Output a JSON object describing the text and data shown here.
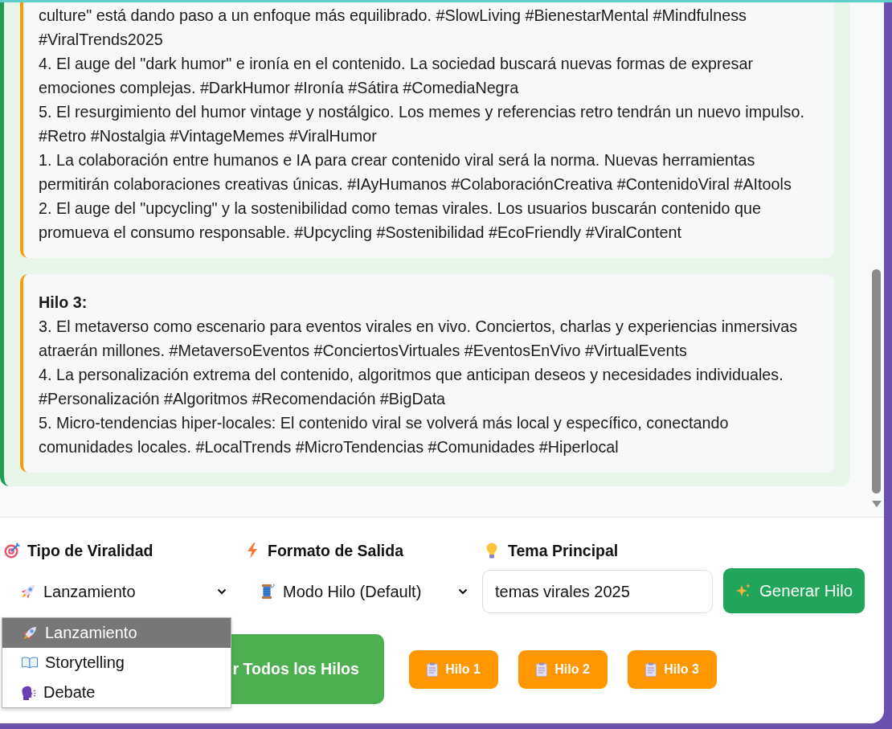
{
  "output": {
    "threads": [
      {
        "items": [
          "culture\" está dando paso a un enfoque más equilibrado. #SlowLiving #BienestarMental #Mindfulness #ViralTrends2025",
          "4. El auge del \"dark humor\" e ironía en el contenido. La sociedad buscará nuevas formas de expresar emociones complejas. #DarkHumor #Ironía #Sátira #ComediaNegra",
          "5. El resurgimiento del humor vintage y nostálgico. Los memes y referencias retro tendrán un nuevo impulso. #Retro #Nostalgia #VintageMemes #ViralHumor",
          "1. La colaboración entre humanos e IA para crear contenido viral será la norma. Nuevas herramientas permitirán colaboraciones creativas únicas. #IAyHumanos #ColaboraciónCreativa #ContenidoViral #AItools",
          "2. El auge del \"upcycling\" y la sostenibilidad como temas virales. Los usuarios buscarán contenido que promueva el consumo responsable. #Upcycling #Sostenibilidad #EcoFriendly #ViralContent"
        ]
      },
      {
        "title": "Hilo 3:",
        "items": [
          "3. El metaverso como escenario para eventos virales en vivo. Conciertos, charlas y experiencias inmersivas atraerán millones. #MetaversoEventos #ConciertosVirtuales #EventosEnVivo #VirtualEvents",
          "4. La personalización extrema del contenido, algoritmos que anticipan deseos y necesidades individuales. #Personalización #Algoritmos #Recomendación #BigData",
          "5. Micro-tendencias hiper-locales: El contenido viral se volverá más local y específico, conectando comunidades locales. #LocalTrends #MicroTendencias #Comunidades #Hiperlocal"
        ]
      }
    ]
  },
  "controls": {
    "fields": [
      {
        "kind": "select",
        "label": "Tipo de Viralidad",
        "value": "Lanzamiento",
        "expanded": true,
        "options": [
          {
            "label": "Lanzamiento",
            "selected": true
          },
          {
            "label": "Storytelling",
            "selected": false
          },
          {
            "label": "Debate",
            "selected": false
          }
        ]
      },
      {
        "kind": "select",
        "label": "Formato de Salida",
        "value": "Modo Hilo (Default)"
      },
      {
        "kind": "text",
        "label": "Tema Principal",
        "value": "temas virales 2025"
      }
    ],
    "generate_button": {
      "label": "Generar Hilo"
    },
    "copy_all_button": {
      "label": "r Todos los Hilos"
    },
    "copy_buttons": [
      {
        "label": "Hilo 1"
      },
      {
        "label": "Hilo 2"
      },
      {
        "label": "Hilo 3"
      }
    ]
  }
}
